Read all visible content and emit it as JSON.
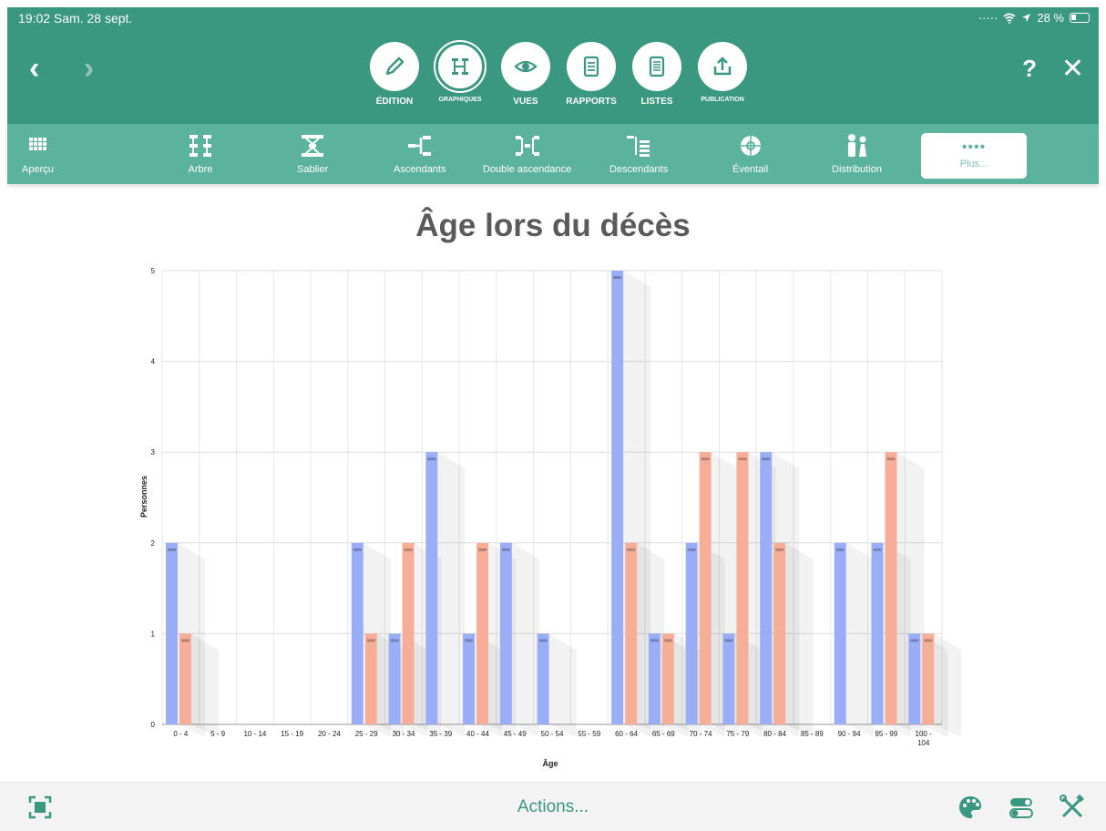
{
  "status": {
    "time": "19:02  Sam. 28 sept.",
    "battery": "28 %"
  },
  "nav": {
    "back": "‹",
    "forward": "›",
    "help": "?",
    "close": "✕"
  },
  "modes": [
    {
      "label": "ÉDITION",
      "icon": "pencil-icon"
    },
    {
      "label": "GRAPHIQUES",
      "icon": "tree-chart-icon",
      "active": true
    },
    {
      "label": "VUES",
      "icon": "eye-icon"
    },
    {
      "label": "RAPPORTS",
      "icon": "report-icon"
    },
    {
      "label": "LISTES",
      "icon": "list-icon"
    },
    {
      "label": "PUBLICATION",
      "icon": "upload-icon"
    }
  ],
  "chart_types": [
    {
      "label": "Aperçu",
      "icon": "grid-icon"
    },
    {
      "label": "Arbre",
      "icon": "tree-icon"
    },
    {
      "label": "Sablier",
      "icon": "hourglass-icon"
    },
    {
      "label": "Ascendants",
      "icon": "ancestors-icon"
    },
    {
      "label": "Double ascendance",
      "icon": "double-ancestry-icon"
    },
    {
      "label": "Descendants",
      "icon": "descendants-icon"
    },
    {
      "label": "Éventail",
      "icon": "fan-icon"
    },
    {
      "label": "Distribution",
      "icon": "distribution-icon"
    },
    {
      "label": "Plus...",
      "icon": "more-icon",
      "selected": true
    }
  ],
  "chart_data": {
    "type": "bar",
    "title": "Âge lors du décès",
    "xlabel": "Âge",
    "ylabel": "Personnes",
    "ylim": [
      0,
      5
    ],
    "yticks": [
      "0",
      "1",
      "2",
      "3",
      "4",
      "5"
    ],
    "grid": true,
    "categories": [
      "0 - 4",
      "5 - 9",
      "10 - 14",
      "15 - 19",
      "20 - 24",
      "25 - 29",
      "30 - 34",
      "35 - 39",
      "40 - 44",
      "45 - 49",
      "50 - 54",
      "55 - 59",
      "60 - 64",
      "65 - 69",
      "70 - 74",
      "75 - 79",
      "80 - 84",
      "85 - 89",
      "90 - 94",
      "95 - 99",
      "100 - 104"
    ],
    "series": [
      {
        "values": [
          2,
          0,
          0,
          0,
          0,
          2,
          1,
          3,
          1,
          2,
          1,
          0,
          5,
          1,
          2,
          1,
          3,
          0,
          2,
          2,
          1
        ],
        "color": "#9aaef7"
      },
      {
        "values": [
          1,
          0,
          0,
          0,
          0,
          1,
          2,
          0,
          2,
          0,
          0,
          0,
          2,
          1,
          3,
          3,
          2,
          0,
          0,
          3,
          1
        ],
        "color": "#f6ae99"
      }
    ]
  },
  "bottom": {
    "actions": "Actions..."
  },
  "colors": {
    "toolbar": "#3a9880",
    "typebar": "#5cb39d",
    "accent": "#3a9880"
  }
}
